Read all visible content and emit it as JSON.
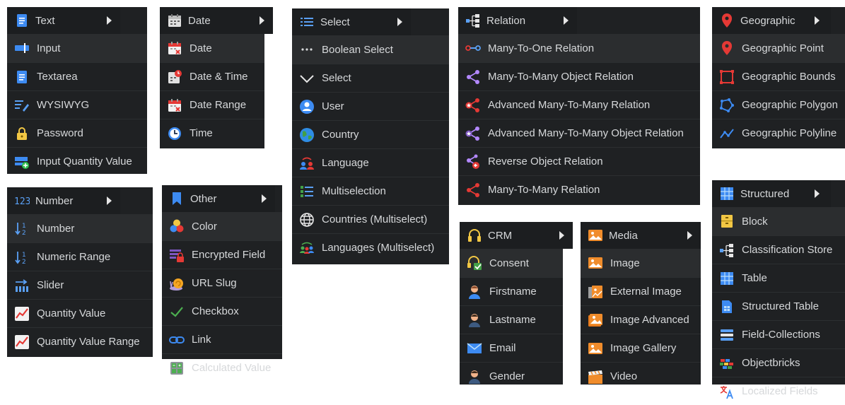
{
  "menus": [
    {
      "title": "Text",
      "icon": "text-icon",
      "items": [
        {
          "label": "Input",
          "icon": "input-icon"
        },
        {
          "label": "Textarea",
          "icon": "textarea-icon"
        },
        {
          "label": "WYSIWYG",
          "icon": "wysiwyg-icon"
        },
        {
          "label": "Password",
          "icon": "password-icon"
        },
        {
          "label": "Input Quantity Value",
          "icon": "input-quantity-icon"
        }
      ]
    },
    {
      "title": "Number",
      "icon": "number-icon",
      "items": [
        {
          "label": "Number",
          "icon": "sort-numeric-icon"
        },
        {
          "label": "Numeric Range",
          "icon": "sort-numeric-icon"
        },
        {
          "label": "Slider",
          "icon": "slider-icon"
        },
        {
          "label": "Quantity Value",
          "icon": "quantity-icon"
        },
        {
          "label": "Quantity Value Range",
          "icon": "quantity-icon"
        }
      ]
    },
    {
      "title": "Date",
      "icon": "calendar-icon",
      "items": [
        {
          "label": "Date",
          "icon": "calendar-red-icon"
        },
        {
          "label": "Date & Time",
          "icon": "calendar-clock-icon"
        },
        {
          "label": "Date Range",
          "icon": "calendar-red-icon"
        },
        {
          "label": "Time",
          "icon": "clock-icon"
        }
      ]
    },
    {
      "title": "Other",
      "icon": "bookmark-icon",
      "items": [
        {
          "label": "Color",
          "icon": "color-icon"
        },
        {
          "label": "Encrypted Field",
          "icon": "encrypted-icon"
        },
        {
          "label": "URL Slug",
          "icon": "snail-icon"
        },
        {
          "label": "Checkbox",
          "icon": "check-icon"
        },
        {
          "label": "Link",
          "icon": "link-icon"
        },
        {
          "label": "Calculated Value",
          "icon": "calculator-icon"
        }
      ]
    },
    {
      "title": "Select",
      "icon": "list-icon",
      "items": [
        {
          "label": "Boolean Select",
          "icon": "dots-icon"
        },
        {
          "label": "Select",
          "icon": "chevron-down-icon"
        },
        {
          "label": "User",
          "icon": "user-icon"
        },
        {
          "label": "Country",
          "icon": "globe-icon"
        },
        {
          "label": "Language",
          "icon": "language-icon"
        },
        {
          "label": "Multiselection",
          "icon": "multiselect-icon"
        },
        {
          "label": "Countries (Multiselect)",
          "icon": "globe-outline-icon"
        },
        {
          "label": "Languages (Multiselect)",
          "icon": "languages-icon"
        }
      ]
    },
    {
      "title": "Relation",
      "icon": "relation-icon",
      "items": [
        {
          "label": "Many-To-One Relation",
          "icon": "many-to-one-icon"
        },
        {
          "label": "Many-To-Many Object Relation",
          "icon": "share-purple-icon"
        },
        {
          "label": "Advanced Many-To-Many Relation",
          "icon": "share-red-star-icon"
        },
        {
          "label": "Advanced Many-To-Many Object Relation",
          "icon": "share-purple-star-icon"
        },
        {
          "label": "Reverse Object Relation",
          "icon": "reverse-relation-icon"
        },
        {
          "label": "Many-To-Many Relation",
          "icon": "share-red-icon"
        }
      ]
    },
    {
      "title": "CRM",
      "icon": "headset-icon",
      "items": [
        {
          "label": "Consent",
          "icon": "consent-icon"
        },
        {
          "label": "Firstname",
          "icon": "person-icon"
        },
        {
          "label": "Lastname",
          "icon": "person-dark-icon"
        },
        {
          "label": "Email",
          "icon": "email-icon"
        },
        {
          "label": "Gender",
          "icon": "person-dark-icon"
        }
      ]
    },
    {
      "title": "Media",
      "icon": "image-icon",
      "items": [
        {
          "label": "Image",
          "icon": "image-icon"
        },
        {
          "label": "External Image",
          "icon": "external-image-icon"
        },
        {
          "label": "Image Advanced",
          "icon": "image-advanced-icon"
        },
        {
          "label": "Image Gallery",
          "icon": "image-icon"
        },
        {
          "label": "Video",
          "icon": "video-icon"
        }
      ]
    },
    {
      "title": "Geographic",
      "icon": "marker-icon",
      "items": [
        {
          "label": "Geographic Point",
          "icon": "marker-icon"
        },
        {
          "label": "Geographic Bounds",
          "icon": "bounds-icon"
        },
        {
          "label": "Geographic Polygon",
          "icon": "polygon-icon"
        },
        {
          "label": "Geographic Polyline",
          "icon": "polyline-icon"
        }
      ]
    },
    {
      "title": "Structured",
      "icon": "grid-icon",
      "items": [
        {
          "label": "Block",
          "icon": "block-icon"
        },
        {
          "label": "Classification Store",
          "icon": "relation-icon"
        },
        {
          "label": "Table",
          "icon": "grid-icon"
        },
        {
          "label": "Structured Table",
          "icon": "structured-table-icon"
        },
        {
          "label": "Field-Collections",
          "icon": "field-collections-icon"
        },
        {
          "label": "Objectbricks",
          "icon": "objectbricks-icon"
        },
        {
          "label": "Localized Fields",
          "icon": "translate-icon"
        }
      ]
    }
  ]
}
